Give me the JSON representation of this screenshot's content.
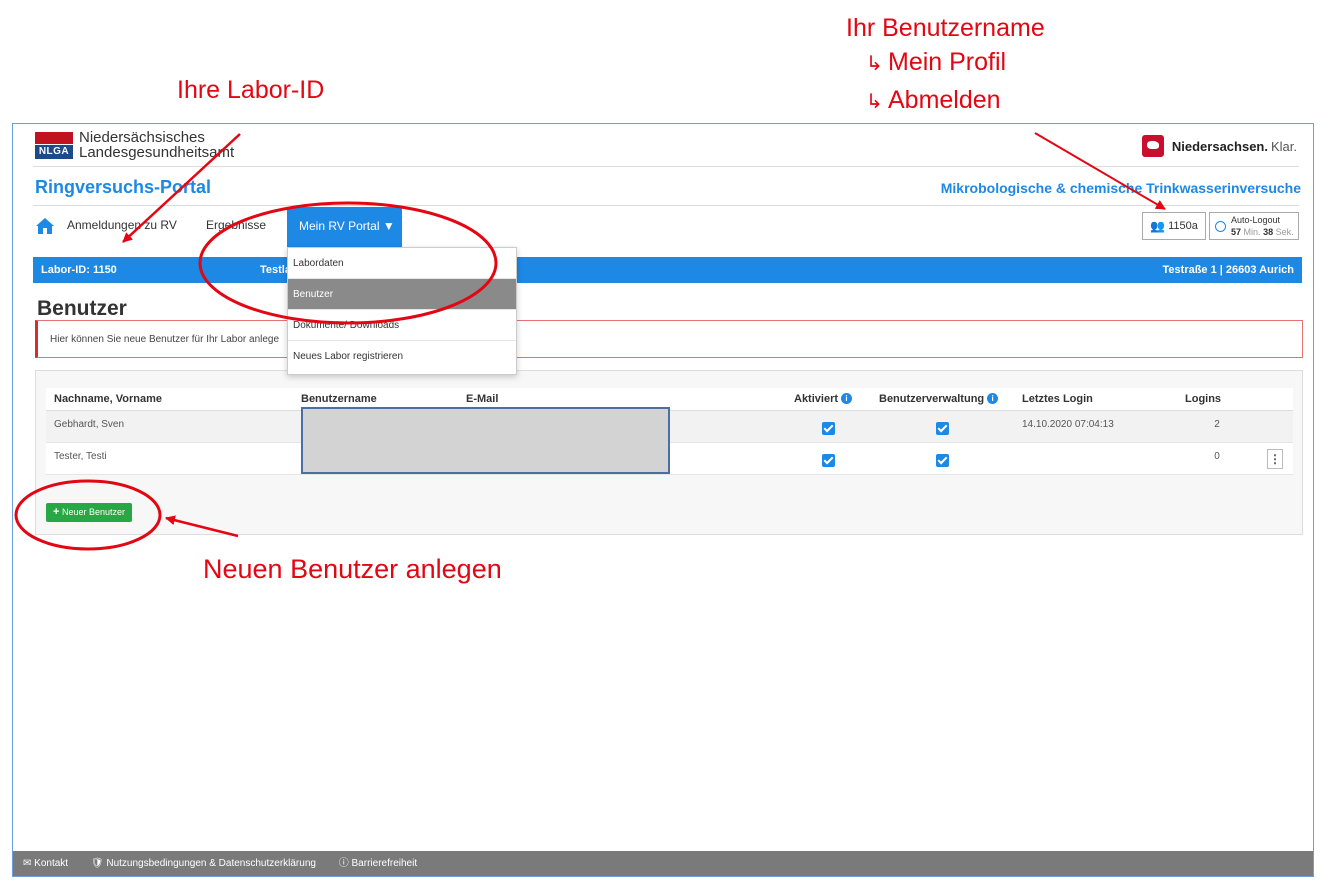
{
  "annotations": {
    "username": "Ihr Benutzername",
    "profile": "Mein Profil",
    "logout": "Abmelden",
    "lab_id": "Ihre Labor-ID",
    "new_user": "Neuen Benutzer anlegen",
    "arrow_glyph": "↳"
  },
  "header": {
    "org_name_line1": "Niedersächsisches",
    "org_name_line2": "Landesgesundheitsamt",
    "logo_text": "NLGA",
    "ns_brand": "Niedersachsen.",
    "ns_claim": "Klar."
  },
  "portal": {
    "title": "Ringversuchs-Portal",
    "subtitle": "Mikrobologische & chemische Trinkwasserinversuche"
  },
  "nav": {
    "items": [
      "Anmeldungen zu RV",
      "Ergebnisse"
    ],
    "active": "Mein RV Portal ▼",
    "username": "1150a",
    "logout_label": "Auto-Logout",
    "logout_min": "57",
    "logout_min_unit": "Min.",
    "logout_sec": "38",
    "logout_sec_unit": "Sek."
  },
  "dropdown": {
    "items": [
      "Labordaten",
      "Benutzer",
      "Dokumente/ Downloads",
      "Neues Labor registrieren"
    ],
    "active_index": 1
  },
  "infobar": {
    "lab_id": "Labor-ID: 1150",
    "lab_name": "Testlab",
    "address": "Testraße 1 | 26603 Aurich"
  },
  "page": {
    "heading": "Benutzer",
    "alert": "Hier können Sie neue Benutzer für Ihr Labor anlege"
  },
  "table": {
    "headers": [
      "Nachname, Vorname",
      "Benutzername",
      "E-Mail",
      "Aktiviert",
      "Benutzerverwaltung",
      "Letztes Login",
      "Logins"
    ],
    "rows": [
      {
        "name": "Gebhardt, Sven",
        "activated": true,
        "admin": true,
        "last_login": "14.10.2020 07:04:13",
        "logins": "2"
      },
      {
        "name": "Tester, Testi",
        "activated": true,
        "admin": true,
        "last_login": "",
        "logins": "0"
      }
    ]
  },
  "new_user_button": "Neuer Benutzer",
  "footer": {
    "contact": "Kontakt",
    "terms": "Nutzungsbedingungen & Datenschutzerklärung",
    "accessibility": "Barrierefreiheit"
  },
  "colors": {
    "accent": "#1e88e5",
    "annotation": "#e30613",
    "button_green": "#28a745",
    "footer": "#7a7a7a"
  }
}
